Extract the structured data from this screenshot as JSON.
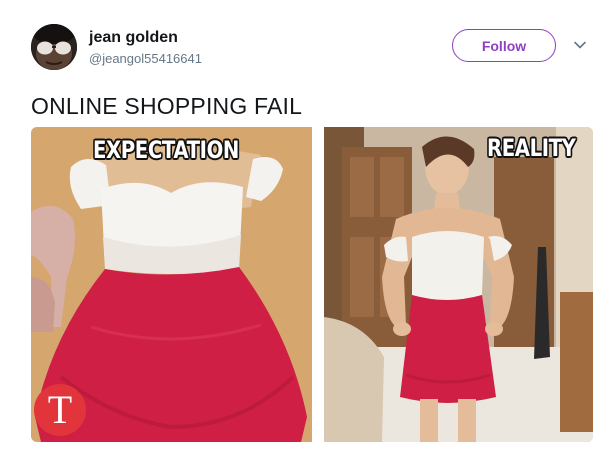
{
  "tweet": {
    "author": {
      "display_name": "jean golden",
      "handle": "@jeangol55416641",
      "avatar_icon": "avatar-sunglasses"
    },
    "follow_label": "Follow",
    "menu_icon": "chevron-down-icon",
    "text": "ONLINE SHOPPING FAIL",
    "media": {
      "left_caption": "EXPECTATION",
      "right_caption": "REALITY",
      "badge_letter": "T"
    }
  },
  "colors": {
    "accent": "#8f3fc4",
    "text_primary": "#14171a",
    "text_secondary": "#657786",
    "dress_red": "#cf1f45",
    "badge_red": "#e2343b"
  }
}
